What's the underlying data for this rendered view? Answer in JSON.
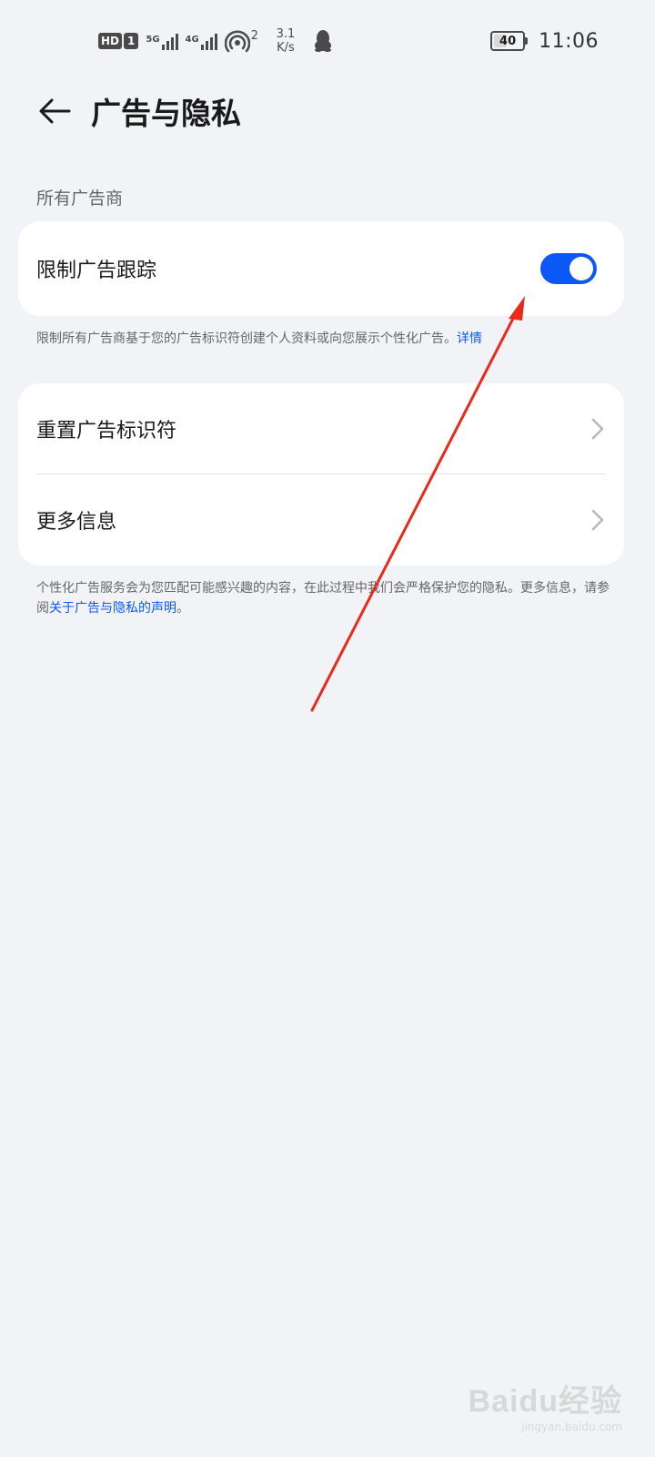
{
  "status_bar": {
    "hd_label": "HD",
    "sim_label": "1",
    "network_1": "5G",
    "network_2": "4G",
    "hotspot_count": "2",
    "speed_value": "3.1",
    "speed_unit": "K/s",
    "battery_level": "40",
    "time": "11:06",
    "icons": [
      "hd-voice-icon",
      "signal-icon",
      "hotspot-icon",
      "qq-icon",
      "battery-icon"
    ]
  },
  "header": {
    "title": "广告与隐私",
    "back_icon": "arrow-left-icon"
  },
  "section": {
    "label": "所有广告商"
  },
  "limit_tracking": {
    "label": "限制广告跟踪",
    "enabled": true,
    "accent_color": "#0a59f7",
    "description": "限制所有广告商基于您的广告标识符创建个人资料或向您展示个性化广告。",
    "details_link": "详情"
  },
  "menu": {
    "items": [
      {
        "label": "重置广告标识符",
        "icon": "chevron-right-icon"
      },
      {
        "label": "更多信息",
        "icon": "chevron-right-icon"
      }
    ]
  },
  "footer": {
    "text_before": "个性化广告服务会为您匹配可能感兴趣的内容，在此过程中我们会严格保护您的隐私。更多信息，请参阅",
    "link": "关于广告与隐私的声明",
    "text_after": "。"
  },
  "annotation": {
    "color": "#e8291c"
  },
  "watermark": {
    "logo": "Baidu经验",
    "url": "jingyan.baidu.com"
  }
}
